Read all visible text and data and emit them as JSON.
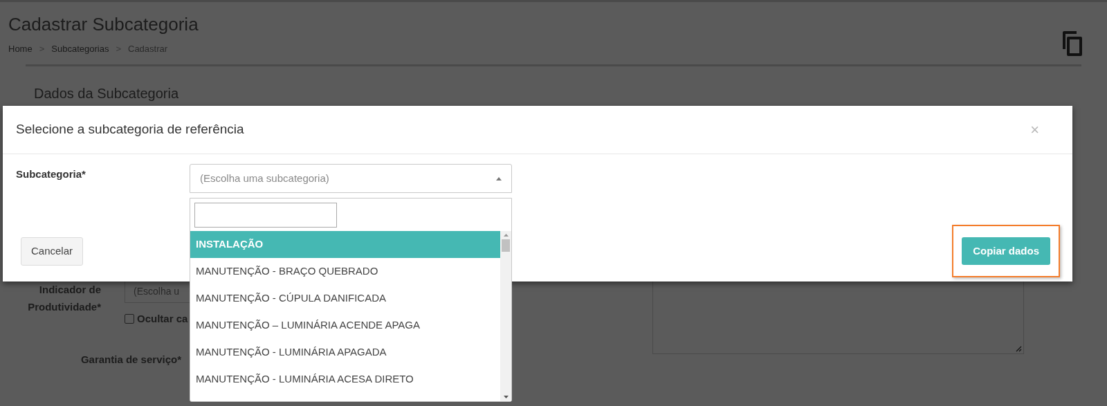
{
  "page": {
    "title": "Cadastrar Subcategoria",
    "breadcrumb": [
      {
        "kind": "link",
        "label": "Home"
      },
      {
        "kind": "separator",
        "label": ">"
      },
      {
        "kind": "link",
        "label": "Subcategorias"
      },
      {
        "kind": "separator",
        "label": ">"
      },
      {
        "kind": "current",
        "label": "Cadastrar"
      }
    ]
  },
  "form": {
    "section_title": "Dados da Subcategoria",
    "productivity_label": "Indicador de Produtividade*",
    "productivity_select": "(Escolha u",
    "hide_checkbox": {
      "label": "Ocultar ca",
      "checked": false
    },
    "warranty_label": "Garantia de serviço*"
  },
  "modal": {
    "title": "Selecione a subcategoria de referência",
    "close": "×",
    "field_label": "Subcategoria*",
    "select": {
      "placeholder": "(Escolha uma subcategoria)",
      "expanded": true
    },
    "options": [
      {
        "label": "INSTALAÇÃO",
        "selected": true
      },
      {
        "label": "MANUTENÇÃO - BRAÇO QUEBRADO",
        "selected": false
      },
      {
        "label": "MANUTENÇÃO - CÚPULA DANIFICADA",
        "selected": false
      },
      {
        "label": "MANUTENÇÃO – LUMINÁRIA ACENDE APAGA",
        "selected": false
      },
      {
        "label": "MANUTENÇÃO - LUMINÁRIA APAGADA",
        "selected": false
      },
      {
        "label": "MANUTENÇÃO - LUMINÁRIA ACESA DIRETO",
        "selected": false
      }
    ],
    "buttons": [
      {
        "label": "Cancelar",
        "kind": "default",
        "highlighted": false
      },
      {
        "label": "Copiar dados",
        "kind": "primary",
        "highlighted": true
      }
    ]
  }
}
